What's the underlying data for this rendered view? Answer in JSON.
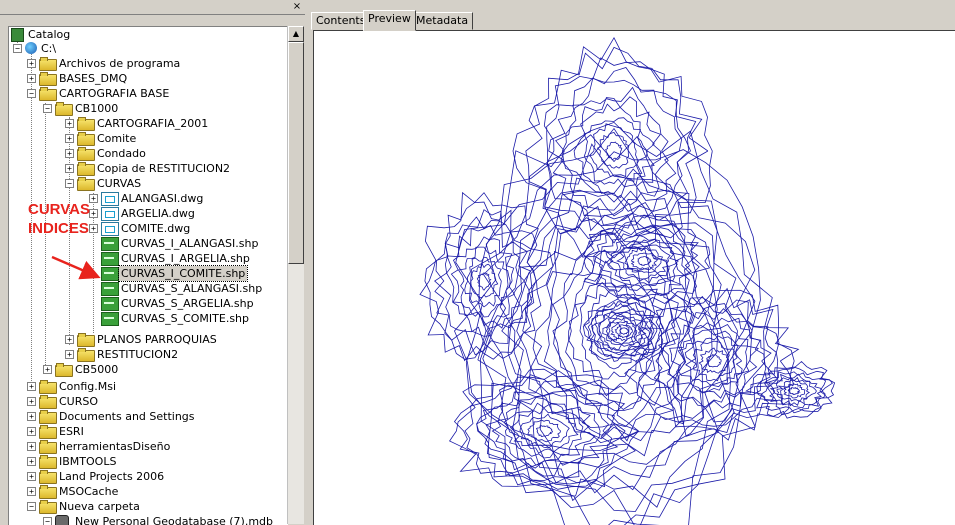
{
  "catalog": {
    "close_glyph": "×",
    "tree": [
      {
        "label": "Catalog",
        "icon": "catalog-icon"
      },
      {
        "label": "C:\\",
        "icon": "drive-icon"
      },
      {
        "label": "Archivos de programa",
        "icon": "folder-icon"
      },
      {
        "label": "BASES_DMQ",
        "icon": "folder-icon"
      },
      {
        "label": "CARTOGRAFIA BASE",
        "icon": "folder-icon"
      },
      {
        "label": "CB1000",
        "icon": "folder-icon"
      },
      {
        "label": "CARTOGRAFIA_2001",
        "icon": "folder-icon"
      },
      {
        "label": "Comite",
        "icon": "folder-icon"
      },
      {
        "label": "Condado",
        "icon": "folder-icon"
      },
      {
        "label": "Copia de RESTITUCION2",
        "icon": "folder-icon"
      },
      {
        "label": "CURVAS",
        "icon": "folder-icon"
      },
      {
        "label": "ALANGASI.dwg",
        "icon": "cad-icon"
      },
      {
        "label": "ARGELIA.dwg",
        "icon": "cad-icon"
      },
      {
        "label": "COMITE.dwg",
        "icon": "cad-icon"
      },
      {
        "label": "CURVAS_I_ALANGASI.shp",
        "icon": "shapefile-icon"
      },
      {
        "label": "CURVAS_I_ARGELIA.shp",
        "icon": "shapefile-icon"
      },
      {
        "label": "CURVAS_I_COMITE.shp",
        "icon": "shapefile-icon"
      },
      {
        "label": "CURVAS_S_ALANGASI.shp",
        "icon": "shapefile-icon"
      },
      {
        "label": "CURVAS_S_ARGELIA.shp",
        "icon": "shapefile-icon"
      },
      {
        "label": "CURVAS_S_COMITE.shp",
        "icon": "shapefile-icon"
      },
      {
        "label": "PLANOS PARROQUIAS",
        "icon": "folder-icon"
      },
      {
        "label": "RESTITUCION2",
        "icon": "folder-icon"
      },
      {
        "label": "CB5000",
        "icon": "folder-icon"
      },
      {
        "label": "Config.Msi",
        "icon": "folder-icon"
      },
      {
        "label": "CURSO",
        "icon": "folder-icon"
      },
      {
        "label": "Documents and Settings",
        "icon": "folder-icon"
      },
      {
        "label": "ESRI",
        "icon": "folder-icon"
      },
      {
        "label": "herramientasDiseño",
        "icon": "folder-icon"
      },
      {
        "label": "IBMTOOLS",
        "icon": "folder-icon"
      },
      {
        "label": "Land Projects 2006",
        "icon": "folder-icon"
      },
      {
        "label": "MSOCache",
        "icon": "folder-icon"
      },
      {
        "label": "Nueva carpeta",
        "icon": "folder-icon"
      },
      {
        "label": "New Personal Geodatabase (7).mdb",
        "icon": "geodatabase-icon"
      }
    ],
    "selected_item": "CURVAS_I_COMITE.shp"
  },
  "annotation": {
    "line1": "CURVAS",
    "line2": "INDICES",
    "color": "#e8231d"
  },
  "tabs": [
    {
      "label": "Contents"
    },
    {
      "label": "Preview"
    },
    {
      "label": "Metadata"
    }
  ],
  "active_tab": "Preview",
  "preview": {
    "line_color": "#1a1aa8"
  }
}
